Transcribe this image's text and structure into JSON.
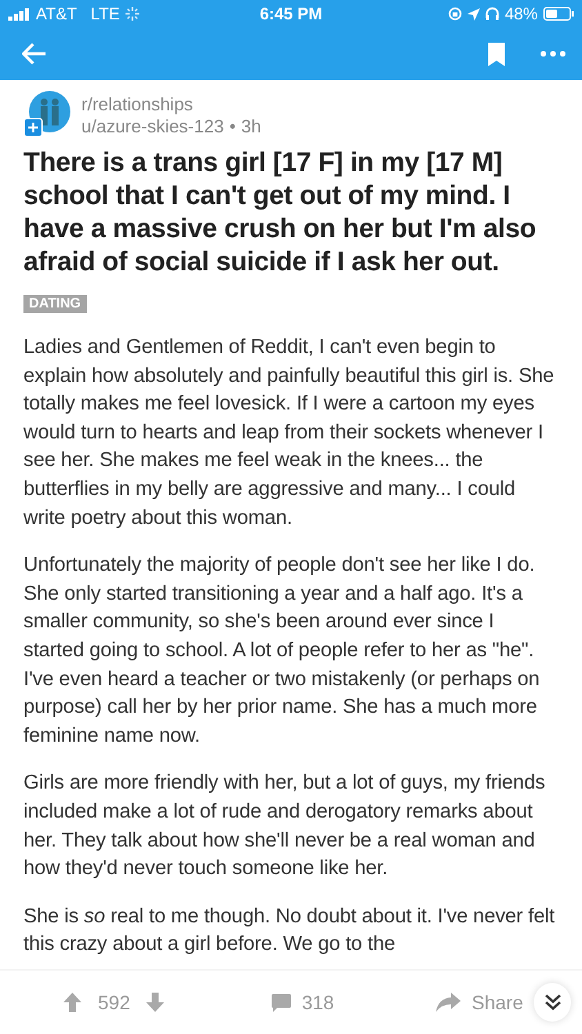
{
  "status_bar": {
    "carrier": "AT&T",
    "network": "LTE",
    "time": "6:45 PM",
    "battery": "48%"
  },
  "post": {
    "subreddit": "r/relationships",
    "author": "u/azure-skies-123",
    "separator": "•",
    "age": "3h",
    "title": "There is a trans girl [17 F] in my [17 M] school that I can't get out of my mind. I have a massive crush on her but I'm also afraid of social suicide if I ask her out.",
    "flair": "DATING",
    "paragraphs": [
      "Ladies and Gentlemen of Reddit, I can't even begin to explain how absolutely and painfully beautiful this girl is. She totally makes me feel lovesick. If I were a cartoon my eyes would turn to hearts and leap from their sockets whenever I see her. She makes me feel weak in the knees... the butterflies in my belly are aggressive and many... I could write poetry about this woman.",
      "Unfortunately the majority of people don't see her like I do. She only started transitioning a year and a half ago. It's a smaller community, so she's been around ever since I started going to school. A lot of people refer to her as \"he\". I've even heard a teacher or two mistakenly (or perhaps on purpose) call her by her prior name. She has a much more feminine name now.",
      "Girls are more friendly with her, but a lot of guys, my friends included make a lot of rude and derogatory remarks about her. They talk about how she'll never be a real woman and how they'd never touch someone like her.",
      "She is *so* real to me though. No doubt about it. I've never felt this crazy about a girl before. We go to the"
    ]
  },
  "footer": {
    "score": "592",
    "comments": "318",
    "share": "Share"
  }
}
